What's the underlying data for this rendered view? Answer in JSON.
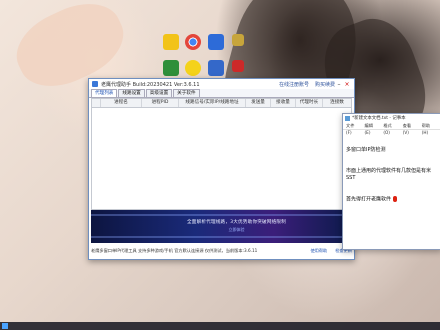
{
  "desktop": {
    "icons": [
      {
        "name": "app-icon-1",
        "color": "#f2c318"
      },
      {
        "name": "chrome-icon",
        "color": "#e3463b"
      },
      {
        "name": "app-icon-3",
        "color": "#2d6bd8"
      },
      {
        "name": "app-icon-4",
        "color": "#c7a53b"
      },
      {
        "name": "app-icon-5",
        "color": "#2f8f3a"
      },
      {
        "name": "app-icon-6",
        "color": "#f4d21a"
      },
      {
        "name": "app-icon-7",
        "color": "#3468c9"
      },
      {
        "name": "app-icon-8",
        "color": "#cc2929"
      }
    ]
  },
  "app": {
    "title": "老鹰代理助手 Build:20230421 Ver:3.6.11",
    "link_register": "在线注册账号",
    "link_buy": "购买续费",
    "tabs": [
      "代理列表",
      "线路设置",
      "高级设置",
      "关于软件"
    ],
    "columns": [
      "",
      "进程名",
      "进程PID",
      "线路信号/实际IP/线路地址",
      "发送量",
      "接收量",
      "代理时长",
      "连接数"
    ],
    "banner_text": "全面解析代理线路，3大优势助你突破网络限制",
    "banner_sub": "立即体验",
    "status_text": "老鹰多窗口单IP代理工具 支持多种游戏/手机 官方默认连接源 仅供测试，当前版本:3.6.11",
    "status_link_1": "使用帮助",
    "status_link_2": "检查更新"
  },
  "notepad": {
    "title": "*新建文本文档.txt - 记事本",
    "menu": [
      "文件(F)",
      "编辑(E)",
      "格式(O)",
      "查看(V)",
      "帮助(H)"
    ],
    "lines": [
      "多窗口单IP防检测",
      "市面上通用的代理软件有几款但是有米SST",
      "首先得打开老鹰软件"
    ]
  }
}
